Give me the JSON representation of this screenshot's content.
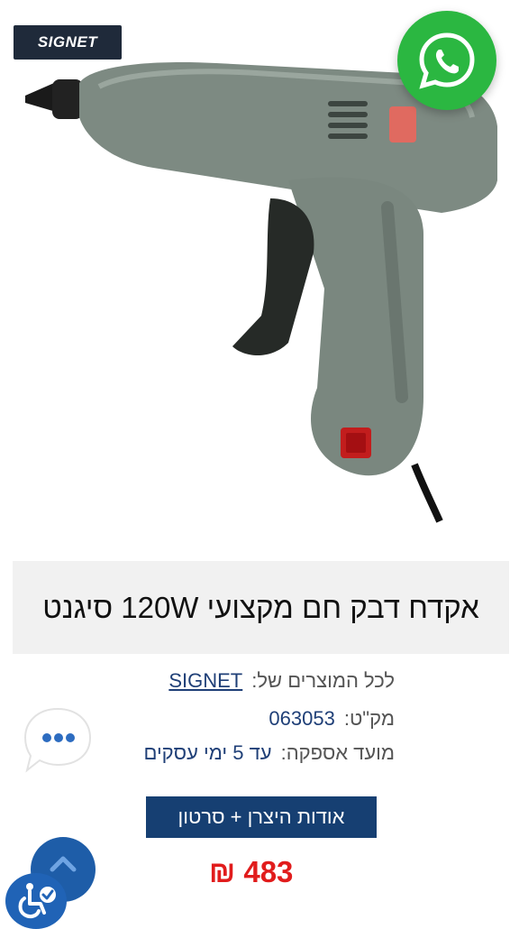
{
  "brand_logo_text": "SIGNET",
  "product": {
    "title": "אקדח דבק חם מקצועי 120W סיגנט",
    "all_products_label": "לכל המוצרים של:",
    "brand_link": "SIGNET",
    "sku_label": "מק\"ט:",
    "sku": "063053",
    "delivery_label": "מועד אספקה:",
    "delivery": "עד 5 ימי עסקים",
    "about_button": "אודות היצרן + סרטון",
    "price": "483 ₪"
  },
  "icons": {
    "whatsapp": "whatsapp-icon",
    "chat": "chat-bubble-icon",
    "scroll_top": "chevron-up-icon",
    "accessibility": "accessibility-icon"
  },
  "colors": {
    "whatsapp": "#2bb741",
    "title_bg": "#f1f1f1",
    "link": "#1f3f77",
    "button_bg": "#163f72",
    "price": "#e11c1c",
    "float_button": "#1e5da8"
  }
}
